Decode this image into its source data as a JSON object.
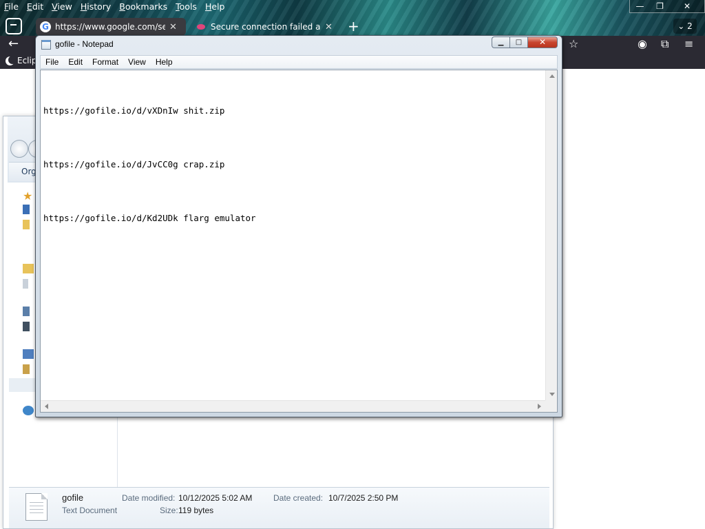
{
  "firefox": {
    "menu": [
      "File",
      "Edit",
      "View",
      "History",
      "Bookmarks",
      "Tools",
      "Help"
    ],
    "tabs": [
      {
        "title": "https://www.google.com/search",
        "favicon": "google-icon"
      },
      {
        "title": "Secure connection failed and Firefox",
        "favicon": "warning-icon"
      }
    ],
    "tab_count": "2",
    "bookmark": "Eclipse",
    "toolbar_icons": [
      "back-icon",
      "star-icon",
      "account-icon",
      "extensions-icon",
      "menu-icon"
    ]
  },
  "explorer": {
    "toolbar_label": "Org",
    "details": {
      "file_name": "gofile",
      "file_type": "Text Document",
      "date_modified_label": "Date modified:",
      "date_modified": "10/12/2025 5:02 AM",
      "date_created_label": "Date created:",
      "date_created": "10/7/2025 2:50 PM",
      "size_label": "Size:",
      "size": "119 bytes"
    }
  },
  "notepad": {
    "title": "gofile - Notepad",
    "menu": [
      "File",
      "Edit",
      "Format",
      "View",
      "Help"
    ],
    "lines": [
      "https://gofile.io/d/vXDnIw shit.zip",
      "https://gofile.io/d/JvCC0g crap.zip",
      "https://gofile.io/d/Kd2UDk flarg emulator"
    ],
    "controls": {
      "minimize": "▁",
      "maximize": "□",
      "close": "✕"
    }
  },
  "colors": {
    "firefox_toolbar": "#2b2a33",
    "notepad_frame": "#cdd8e3",
    "close_red": "#c8452e"
  }
}
